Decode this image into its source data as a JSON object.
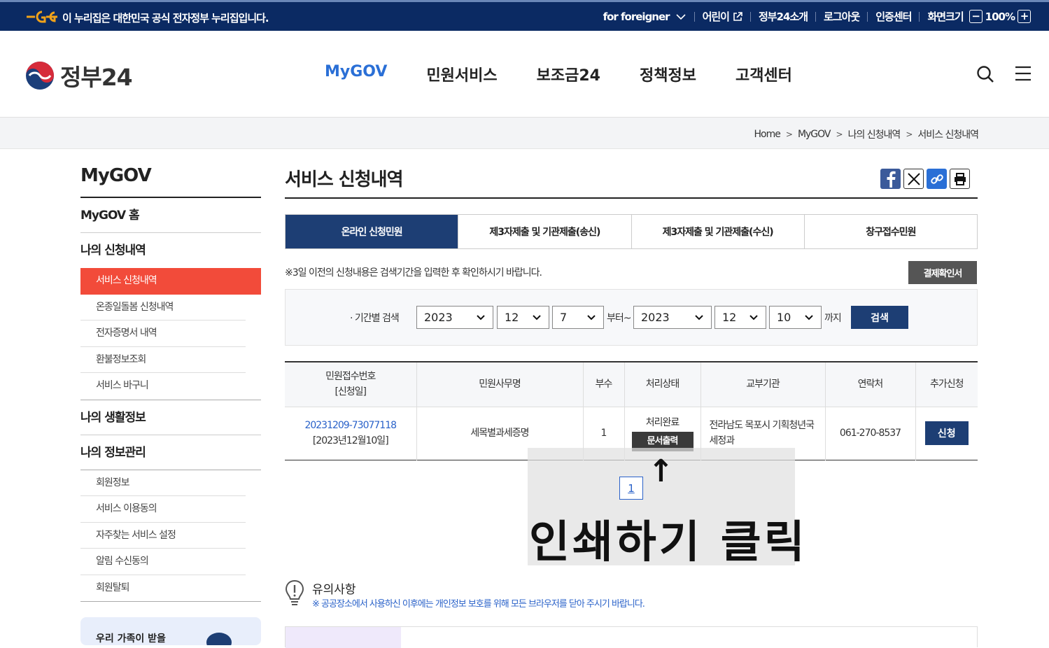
{
  "topbar": {
    "notice": "이 누리집은 대한민국 공식 전자정부 누리집입니다.",
    "links": [
      "for foreigner",
      "어린이",
      "정부24소개",
      "로그아웃",
      "인증센터",
      "화면크기"
    ],
    "zoom_minus": "−",
    "zoom_level": "100%",
    "zoom_plus": "+"
  },
  "header": {
    "logo": "정부24",
    "nav": [
      "MyGOV",
      "민원서비스",
      "보조금24",
      "정책정보",
      "고객센터"
    ],
    "active_nav": "MyGOV"
  },
  "breadcrumb": [
    "Home",
    "MyGOV",
    "나의 신청내역",
    "서비스 신청내역"
  ],
  "sidebar": {
    "title": "MyGOV",
    "home": "MyGOV 홈",
    "section1": "나의 신청내역",
    "section1_items": [
      "서비스 신청내역",
      "온종일돌봄 신청내역",
      "전자증명서 내역",
      "환불정보조회",
      "서비스 바구니"
    ],
    "section2": "나의 생활정보",
    "section3": "나의 정보관리",
    "section3_items": [
      "회원정보",
      "서비스 이용동의",
      "자주찾는 서비스 설정",
      "알림 수신동의",
      "회원탈퇴"
    ],
    "banner": "우리 가족이 받을"
  },
  "main": {
    "title": "서비스 신청내역",
    "tabs": [
      "온라인 신청민원",
      "제3자제출 및 기관제출(송신)",
      "제3자제출 및 기관제출(수신)",
      "창구접수민원"
    ],
    "note": "※3일 이전의 신청내용은 검색기간을 입력한 후 확인하시기 바랍니다.",
    "payment_button": "결제확인서",
    "search": {
      "label": "· 기간별 검색",
      "from_year": "2023",
      "from_month": "12",
      "from_day": "7",
      "from_text": "부터~",
      "to_year": "2023",
      "to_month": "12",
      "to_day": "10",
      "to_text": "까지",
      "button": "검색"
    },
    "table": {
      "headers": [
        "민원접수번호",
        "[신청일]",
        "민원사무명",
        "부수",
        "처리상태",
        "교부기관",
        "연락처",
        "추가신청"
      ],
      "row": {
        "receipt_no": "20231209-73077118",
        "date": "[2023년12월10일]",
        "name": "세목별과세증명",
        "copies": "1",
        "status": "처리완료",
        "print_button": "문서출력",
        "agency_line1": "전라남도 목포시 기획청년국",
        "agency_line2": "세정과",
        "phone": "061-270-8537",
        "apply_button": "신청"
      }
    },
    "page": "1"
  },
  "overlay": {
    "arrow": "↑",
    "text": "인쇄하기 클릭"
  },
  "caution": {
    "title": "유의사항",
    "desc": "※ 공공장소에서 사용하신 이후에는 개인정보 보호를 위해 모든 브라우저를 닫아 주시기 바랍니다."
  },
  "colors": {
    "topbar": "#0b2a63",
    "primary": "#1d3e74",
    "active_side": "#f24b3a",
    "link": "#2a62c9"
  }
}
